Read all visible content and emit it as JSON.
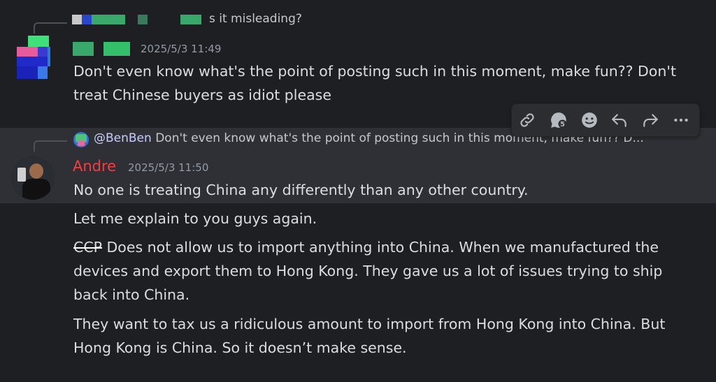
{
  "message1": {
    "reply_preview_text": "s it misleading?",
    "timestamp": "2025/5/3 11:49",
    "lines": [
      "Don't even know what's the point of posting such in this moment, make fun?? Don't",
      "treat Chinese buyers as idiot please"
    ]
  },
  "message2": {
    "reply_mention": "@BenBen",
    "reply_preview_text": "Don't even know what's the point of posting such in this moment, make fun?? D...",
    "author": "Andre",
    "author_color": "#f23f43",
    "timestamp": "2025/5/3 11:50",
    "line1": "No one is treating China any differently than any other country.",
    "line2": "Let me explain to you guys again.",
    "line3_prefix": "CCP",
    "line3_rest": " Does not allow us to import anything into China. When we manufactured the",
    "line4": "devices and export them to Hong Kong. They gave us a lot of issues trying to ship",
    "line5": "back into China.",
    "line6": "They want to tax us a ridiculous amount to import from Hong Kong into China. But",
    "line7": "Hong Kong is China. So it doesn’t make sense."
  },
  "toolbar": {
    "icons": [
      "link-icon",
      "thread-icon",
      "emoji-icon",
      "reply-icon",
      "forward-icon",
      "more-icon"
    ]
  }
}
